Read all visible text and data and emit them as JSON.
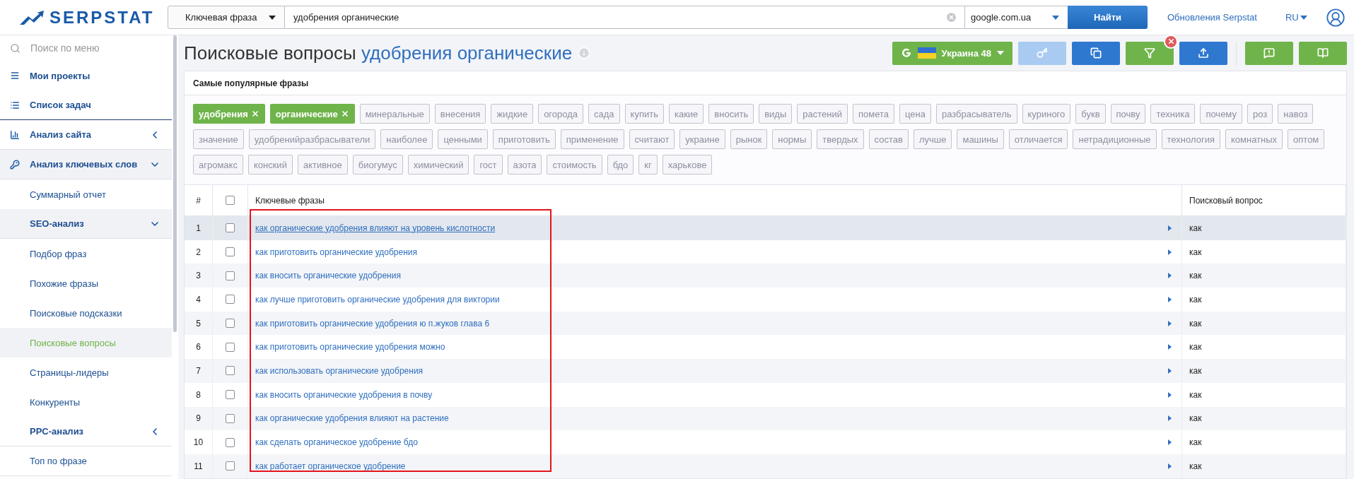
{
  "header": {
    "logo": "SERPSTAT",
    "search_type": "Ключевая фраза",
    "query": "удобрения органические",
    "engine": "google.com.ua",
    "search_button": "Найти",
    "updates_link": "Обновления Serpstat",
    "language": "RU"
  },
  "sidebar": {
    "search_placeholder": "Поиск по меню",
    "items": [
      {
        "label": "Мои проекты",
        "kind": "menu"
      },
      {
        "label": "Список задач",
        "kind": "list"
      },
      {
        "label": "Анализ сайта",
        "kind": "chart",
        "expanded": false
      },
      {
        "label": "Анализ ключевых слов",
        "kind": "key",
        "expanded": true,
        "children": [
          {
            "label": "Суммарный отчет",
            "kind": "sub",
            "selected": false
          },
          {
            "label": "SEO-анализ",
            "kind": "group",
            "expanded": true,
            "children": [
              {
                "label": "Подбор фраз",
                "kind": "sub",
                "selected": false
              },
              {
                "label": "Похожие фразы",
                "kind": "sub",
                "selected": false
              },
              {
                "label": "Поисковые подсказки",
                "kind": "sub",
                "selected": false
              },
              {
                "label": "Поисковые вопросы",
                "kind": "sub",
                "selected": true
              },
              {
                "label": "Страницы-лидеры",
                "kind": "sub",
                "selected": false
              },
              {
                "label": "Конкуренты",
                "kind": "sub",
                "selected": false
              }
            ]
          },
          {
            "label": "PPC-анализ",
            "kind": "group",
            "expanded": false
          },
          {
            "label": "Топ по фразе",
            "kind": "sub",
            "selected": false
          }
        ]
      }
    ]
  },
  "page": {
    "title": "Поисковые вопросы",
    "title_query": "удобрения органические"
  },
  "toolbar": [
    {
      "kind": "region",
      "label": "Украина 48",
      "disabled": false
    },
    {
      "kind": "key",
      "disabled": true
    },
    {
      "kind": "copy",
      "disabled": false
    },
    {
      "kind": "filter",
      "disabled": false,
      "clear_badge": true
    },
    {
      "kind": "export",
      "disabled": false
    },
    {
      "kind": "feedback",
      "disabled": false
    },
    {
      "kind": "help",
      "disabled": false
    }
  ],
  "phrases_panel": {
    "title": "Самые популярные фразы",
    "tags": [
      {
        "label": "удобрения",
        "selected": true
      },
      {
        "label": "органические",
        "selected": true
      },
      {
        "label": "минеральные",
        "selected": false
      },
      {
        "label": "внесения",
        "selected": false
      },
      {
        "label": "жидкие",
        "selected": false
      },
      {
        "label": "огорода",
        "selected": false
      },
      {
        "label": "сада",
        "selected": false
      },
      {
        "label": "купить",
        "selected": false
      },
      {
        "label": "какие",
        "selected": false
      },
      {
        "label": "вносить",
        "selected": false
      },
      {
        "label": "виды",
        "selected": false
      },
      {
        "label": "растений",
        "selected": false
      },
      {
        "label": "помета",
        "selected": false
      },
      {
        "label": "цена",
        "selected": false
      },
      {
        "label": "разбрасыватель",
        "selected": false
      },
      {
        "label": "куриного",
        "selected": false
      },
      {
        "label": "букв",
        "selected": false
      },
      {
        "label": "почву",
        "selected": false
      },
      {
        "label": "техника",
        "selected": false
      },
      {
        "label": "почему",
        "selected": false
      },
      {
        "label": "роз",
        "selected": false
      },
      {
        "label": "навоз",
        "selected": false
      },
      {
        "label": "значение",
        "selected": false
      },
      {
        "label": "удобренийразбрасыватели",
        "selected": false
      },
      {
        "label": "наиболее",
        "selected": false
      },
      {
        "label": "ценными",
        "selected": false
      },
      {
        "label": "приготовить",
        "selected": false
      },
      {
        "label": "применение",
        "selected": false
      },
      {
        "label": "считают",
        "selected": false
      },
      {
        "label": "украине",
        "selected": false
      },
      {
        "label": "рынок",
        "selected": false
      },
      {
        "label": "нормы",
        "selected": false
      },
      {
        "label": "твердых",
        "selected": false
      },
      {
        "label": "состав",
        "selected": false
      },
      {
        "label": "лучше",
        "selected": false
      },
      {
        "label": "машины",
        "selected": false
      },
      {
        "label": "отличается",
        "selected": false
      },
      {
        "label": "нетрадиционные",
        "selected": false
      },
      {
        "label": "технология",
        "selected": false
      },
      {
        "label": "комнатных",
        "selected": false
      },
      {
        "label": "оптом",
        "selected": false
      },
      {
        "label": "агромакс",
        "selected": false
      },
      {
        "label": "конский",
        "selected": false
      },
      {
        "label": "активное",
        "selected": false
      },
      {
        "label": "биогумус",
        "selected": false
      },
      {
        "label": "химический",
        "selected": false
      },
      {
        "label": "гост",
        "selected": false
      },
      {
        "label": "азота",
        "selected": false
      },
      {
        "label": "стоимость",
        "selected": false
      },
      {
        "label": "бдо",
        "selected": false
      },
      {
        "label": "кг",
        "selected": false
      },
      {
        "label": "харькове",
        "selected": false
      }
    ]
  },
  "table": {
    "columns": [
      "#",
      "Ключевые фразы",
      "Поисковый вопрос"
    ],
    "all_checked": false,
    "highlight_frame": true,
    "rows": [
      {
        "number": "1",
        "phrase": "как органические удобрения влияют на уровень кислотности",
        "question": "как",
        "checked": false,
        "hovered": true
      },
      {
        "number": "2",
        "phrase": "как приготовить органические удобрения",
        "question": "как",
        "checked": false,
        "hovered": false
      },
      {
        "number": "3",
        "phrase": "как вносить органические удобрения",
        "question": "как",
        "checked": false,
        "hovered": false
      },
      {
        "number": "4",
        "phrase": "как лучше приготовить органические удобрения для виктории",
        "question": "как",
        "checked": false,
        "hovered": false
      },
      {
        "number": "5",
        "phrase": "как приготовить органические удобрения ю п.жуков глава 6",
        "question": "как",
        "checked": false,
        "hovered": false
      },
      {
        "number": "6",
        "phrase": "как приготовить органические удобрения можно",
        "question": "как",
        "checked": false,
        "hovered": false
      },
      {
        "number": "7",
        "phrase": "как использовать органические удобрения",
        "question": "как",
        "checked": false,
        "hovered": false
      },
      {
        "number": "8",
        "phrase": "как вносить органические удобрения в почву",
        "question": "как",
        "checked": false,
        "hovered": false
      },
      {
        "number": "9",
        "phrase": "как органические удобрения влияют на растение",
        "question": "как",
        "checked": false,
        "hovered": false
      },
      {
        "number": "10",
        "phrase": "как сделать органическое удобрение бдо",
        "question": "как",
        "checked": false,
        "hovered": false
      },
      {
        "number": "11",
        "phrase": "как работает органическое удобрение",
        "question": "как",
        "checked": false,
        "hovered": false
      }
    ]
  }
}
